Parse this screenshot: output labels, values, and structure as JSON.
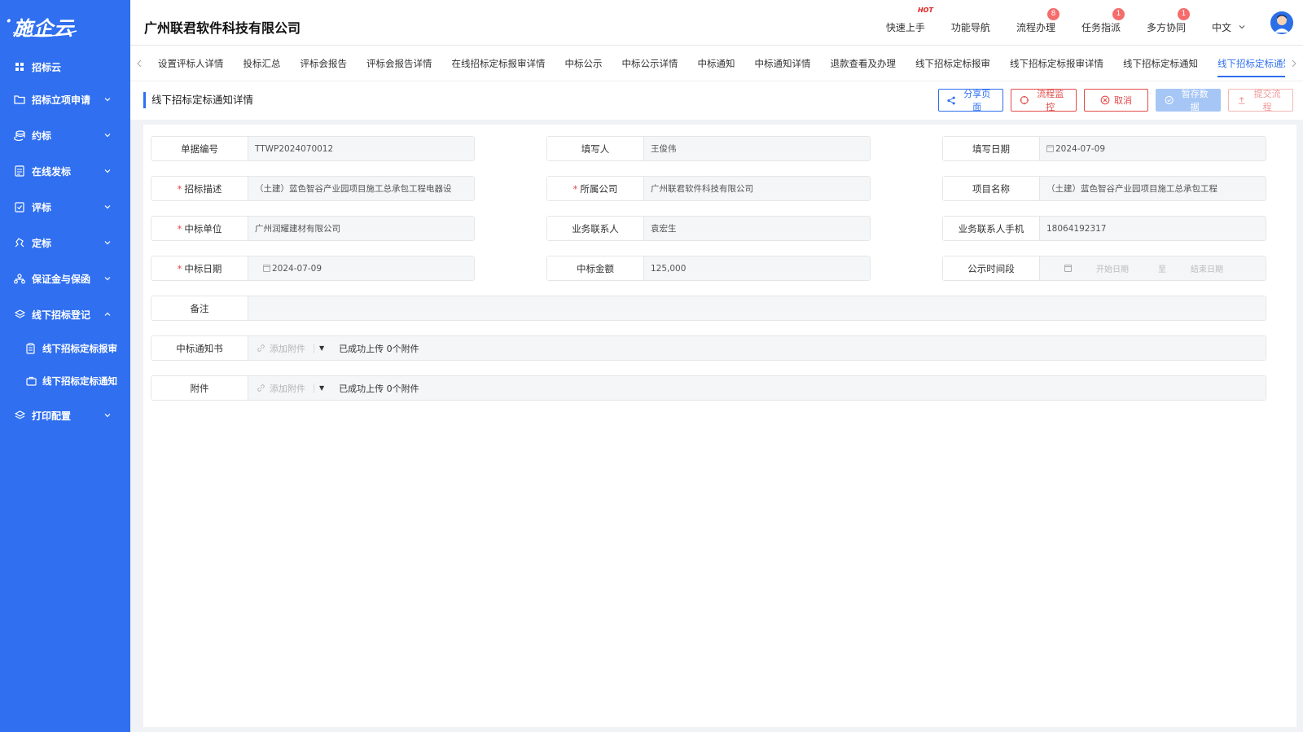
{
  "app": {
    "logo_text": "施企云"
  },
  "sidebar": {
    "items": [
      {
        "label": "招标云",
        "icon": "grid-icon"
      },
      {
        "label": "招标立项申请",
        "icon": "folder-icon"
      },
      {
        "label": "约标",
        "icon": "coins-icon"
      },
      {
        "label": "在线发标",
        "icon": "document-icon"
      },
      {
        "label": "评标",
        "icon": "clipboard-check-icon"
      },
      {
        "label": "定标",
        "icon": "hand-icon"
      },
      {
        "label": "保证金与保函",
        "icon": "org-icon"
      },
      {
        "label": "线下招标登记",
        "icon": "layers-icon"
      },
      {
        "label": "打印配置",
        "icon": "layers-icon"
      }
    ],
    "sub_items": [
      {
        "label": "线下招标定标报审",
        "icon": "clipboard-icon"
      },
      {
        "label": "线下招标定标通知",
        "icon": "briefcase-icon"
      }
    ]
  },
  "header": {
    "company": "广州联君软件科技有限公司",
    "nav": [
      {
        "label": "快速上手",
        "badge": "HOT"
      },
      {
        "label": "功能导航",
        "badge": ""
      },
      {
        "label": "流程办理",
        "badge": "8"
      },
      {
        "label": "任务指派",
        "badge": "1"
      },
      {
        "label": "多方协同",
        "badge": "1"
      }
    ],
    "language": "中文"
  },
  "tabs": [
    "设置评标人详情",
    "投标汇总",
    "评标会报告",
    "评标会报告详情",
    "在线招标定标报审详情",
    "中标公示",
    "中标公示详情",
    "中标通知",
    "中标通知详情",
    "退款查看及办理",
    "线下招标定标报审",
    "线下招标定标报审详情",
    "线下招标定标通知",
    "线下招标定标通知详情"
  ],
  "page": {
    "title": "线下招标定标通知详情",
    "buttons": {
      "share": "分享页面",
      "monitor": "流程监控",
      "cancel": "取消",
      "save": "暂存数据",
      "submit": "提交流程"
    }
  },
  "form": {
    "doc_no": {
      "label": "单据编号",
      "value": "TTWP2024070012"
    },
    "filler": {
      "label": "填写人",
      "value": "王俊伟"
    },
    "fill_date": {
      "label": "填写日期",
      "value": "2024-07-09"
    },
    "tender_desc": {
      "label": "招标描述",
      "value": "（土建）蓝色智谷产业园项目施工总承包工程电器设"
    },
    "company": {
      "label": "所属公司",
      "value": "广州联君软件科技有限公司"
    },
    "project_name": {
      "label": "项目名称",
      "value": "（土建）蓝色智谷产业园项目施工总承包工程"
    },
    "winner": {
      "label": "中标单位",
      "value": "广州润耀建材有限公司"
    },
    "contact": {
      "label": "业务联系人",
      "value": "袁宏生"
    },
    "contact_phone": {
      "label": "业务联系人手机",
      "value": "18064192317"
    },
    "win_date": {
      "label": "中标日期",
      "value": "2024-07-09"
    },
    "win_amount": {
      "label": "中标金额",
      "value": "125,000"
    },
    "publicity": {
      "label": "公示时间段",
      "start_placeholder": "开始日期",
      "separator": "至",
      "end_placeholder": "结束日期"
    },
    "remark": {
      "label": "备注",
      "value": ""
    },
    "notice_doc": {
      "label": "中标通知书",
      "add_label": "添加附件",
      "status": "已成功上传 0个附件"
    },
    "attachment": {
      "label": "附件",
      "add_label": "添加附件",
      "status": "已成功上传 0个附件"
    }
  }
}
